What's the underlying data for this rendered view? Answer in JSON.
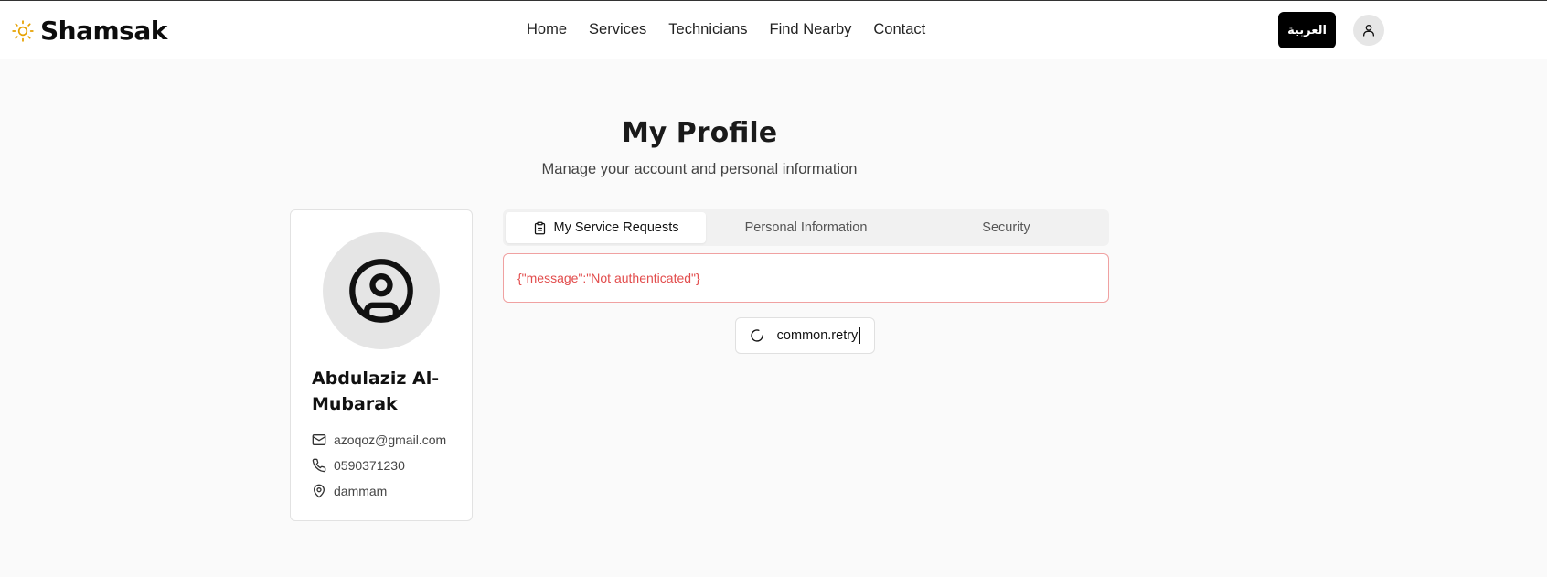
{
  "header": {
    "brand": "Shamsak",
    "nav": [
      "Home",
      "Services",
      "Technicians",
      "Find Nearby",
      "Contact"
    ],
    "language_button": "العربية",
    "accent_color": "#e6a100"
  },
  "page": {
    "title": "My Profile",
    "subtitle": "Manage your account and personal information"
  },
  "profile": {
    "name": "Abdulaziz Al-Mubarak",
    "email": "azoqoz@gmail.com",
    "phone": "0590371230",
    "city": "dammam"
  },
  "tabs": [
    {
      "label": "My Service Requests",
      "active": true
    },
    {
      "label": "Personal Information",
      "active": false
    },
    {
      "label": "Security",
      "active": false
    }
  ],
  "error": {
    "message": "{\"message\":\"Not authenticated\"}",
    "color": "#e24c4c"
  },
  "retry": {
    "label": "common.retry"
  }
}
